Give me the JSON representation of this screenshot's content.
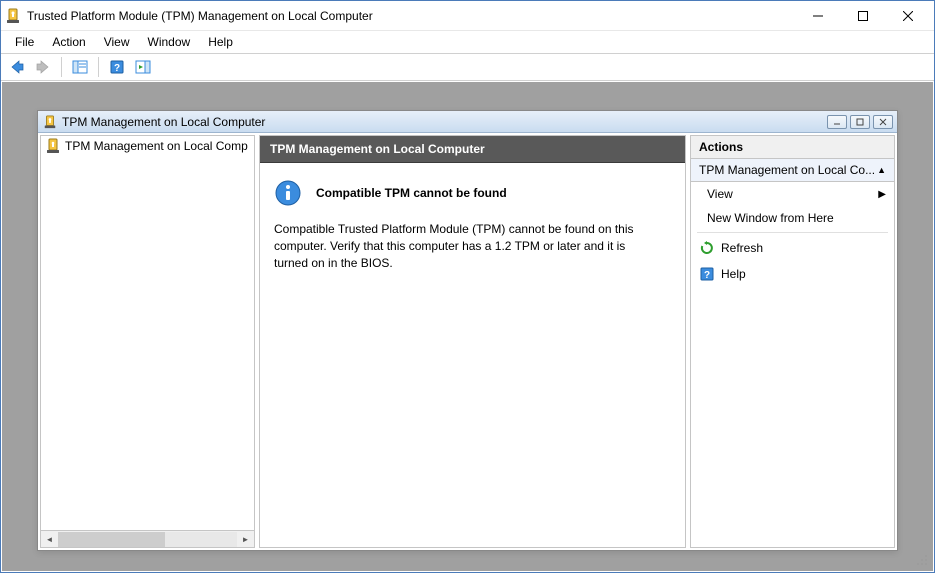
{
  "window": {
    "title": "Trusted Platform Module (TPM) Management on Local Computer"
  },
  "menu": {
    "file": "File",
    "action": "Action",
    "view": "View",
    "window": "Window",
    "help": "Help"
  },
  "mdi": {
    "title": "TPM Management on Local Computer"
  },
  "tree": {
    "item0": "TPM Management on Local Comp"
  },
  "center": {
    "header": "TPM Management on Local Computer",
    "message_title": "Compatible TPM cannot be found",
    "message_body": "Compatible Trusted Platform Module (TPM) cannot be found on this computer. Verify that this computer has a 1.2 TPM or later and it is turned on in the BIOS."
  },
  "actions": {
    "header": "Actions",
    "section": "TPM Management on Local Co...",
    "view": "View",
    "new_window": "New Window from Here",
    "refresh": "Refresh",
    "help": "Help"
  }
}
